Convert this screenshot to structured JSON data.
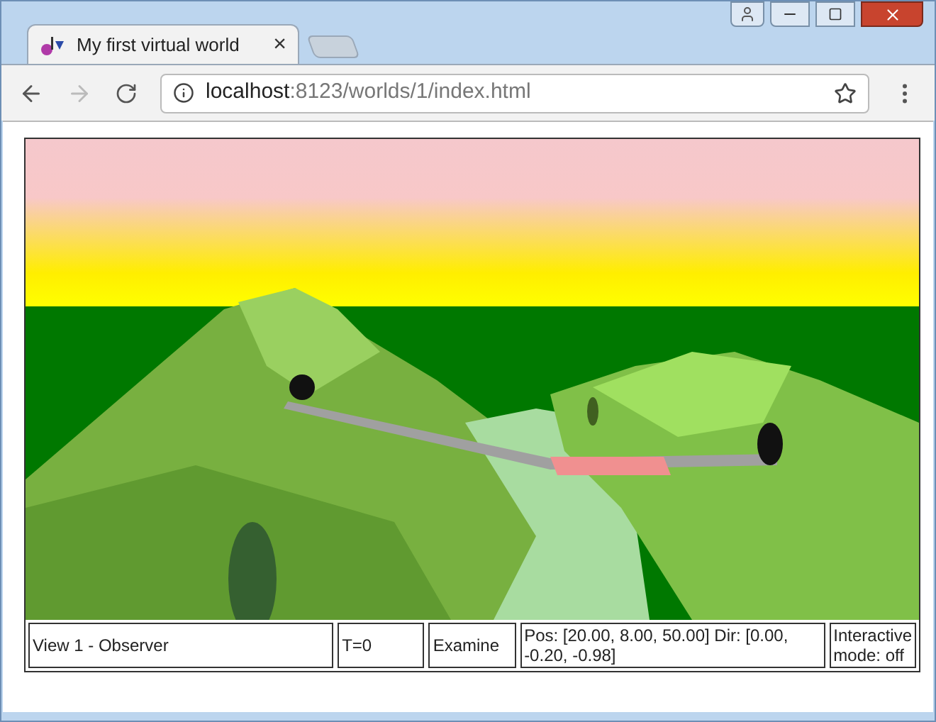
{
  "tab": {
    "title": "My first virtual world",
    "close": "×",
    "selected": true
  },
  "address_bar": {
    "host": "localhost",
    "path": ":8123/worlds/1/index.html"
  },
  "status_bar": [
    {
      "text": "View 1 - Observer"
    },
    {
      "text": "T=0"
    },
    {
      "text": "Examine"
    },
    {
      "text": "Pos: [20.00, 8.00, 50.00] Dir: [0.00, -0.20, -0.98]"
    },
    {
      "text": "Interactive mode: off"
    }
  ]
}
